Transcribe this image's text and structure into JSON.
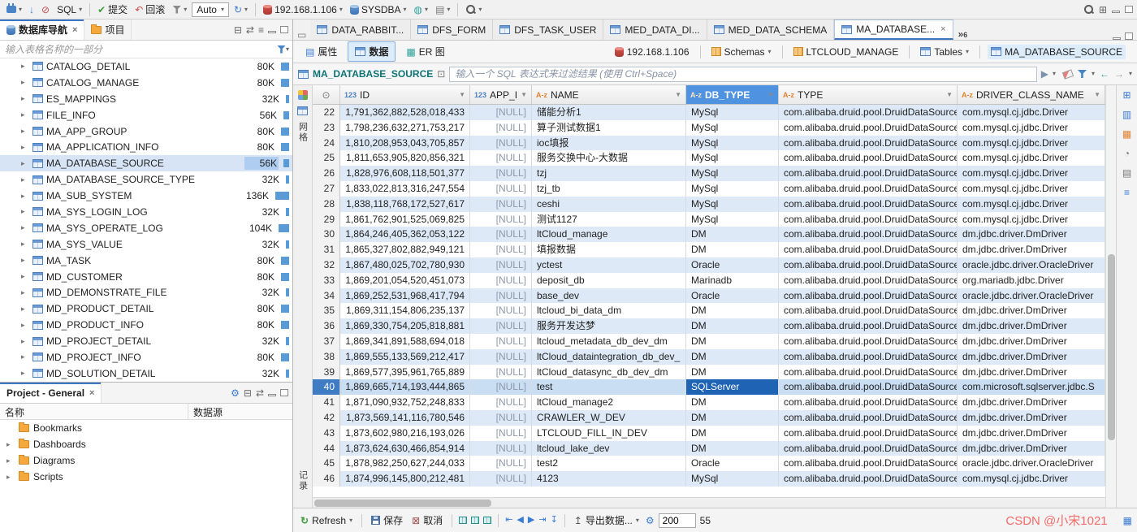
{
  "topbar": {
    "sql_label": "SQL",
    "commit_label": "提交",
    "rollback_label": "回滚",
    "auto_value": "Auto",
    "host": "192.168.1.106",
    "user": "SYSDBA"
  },
  "navigator": {
    "tabs": [
      "数据库导航",
      "项目"
    ],
    "filter_placeholder": "输入表格名称的一部分",
    "tree": [
      {
        "name": "CATALOG_DETAIL",
        "size": "80K"
      },
      {
        "name": "CATALOG_MANAGE",
        "size": "80K"
      },
      {
        "name": "ES_MAPPINGS",
        "size": "32K"
      },
      {
        "name": "FILE_INFO",
        "size": "56K"
      },
      {
        "name": "MA_APP_GROUP",
        "size": "80K"
      },
      {
        "name": "MA_APPLICATION_INFO",
        "size": "80K"
      },
      {
        "name": "MA_DATABASE_SOURCE",
        "size": "56K",
        "selected": true
      },
      {
        "name": "MA_DATABASE_SOURCE_TYPE",
        "size": "32K"
      },
      {
        "name": "MA_SUB_SYSTEM",
        "size": "136K"
      },
      {
        "name": "MA_SYS_LOGIN_LOG",
        "size": "32K"
      },
      {
        "name": "MA_SYS_OPERATE_LOG",
        "size": "104K"
      },
      {
        "name": "MA_SYS_VALUE",
        "size": "32K"
      },
      {
        "name": "MA_TASK",
        "size": "80K"
      },
      {
        "name": "MD_CUSTOMER",
        "size": "80K"
      },
      {
        "name": "MD_DEMONSTRATE_FILE",
        "size": "32K"
      },
      {
        "name": "MD_PRODUCT_DETAIL",
        "size": "80K"
      },
      {
        "name": "MD_PRODUCT_INFO",
        "size": "80K"
      },
      {
        "name": "MD_PROJECT_DETAIL",
        "size": "32K"
      },
      {
        "name": "MD_PROJECT_INFO",
        "size": "80K"
      },
      {
        "name": "MD_SOLUTION_DETAIL",
        "size": "32K"
      }
    ]
  },
  "project": {
    "tab_label": "Project - General",
    "columns": [
      "名称",
      "数据源"
    ],
    "items": [
      {
        "label": "Bookmarks",
        "expandable": false
      },
      {
        "label": "Dashboards",
        "expandable": true
      },
      {
        "label": "Diagrams",
        "expandable": true
      },
      {
        "label": "Scripts",
        "expandable": true
      }
    ]
  },
  "editor": {
    "tabs": [
      {
        "label": "DATA_RABBIT..."
      },
      {
        "label": "DFS_FORM"
      },
      {
        "label": "DFS_TASK_USER"
      },
      {
        "label": "MED_DATA_DI..."
      },
      {
        "label": "MED_DATA_SCHEMA"
      },
      {
        "label": "MA_DATABASE...",
        "active": true
      }
    ],
    "overflow_chevron": "»",
    "overflow_count": "6"
  },
  "subtabs": [
    {
      "label": "属性"
    },
    {
      "label": "数据",
      "active": true
    },
    {
      "label": "ER 图"
    }
  ],
  "breadcrumbs": [
    {
      "icon": "db-red",
      "label": "192.168.1.106",
      "caret": false
    },
    {
      "icon": "schemas",
      "label": "Schemas",
      "caret": true
    },
    {
      "icon": "schema",
      "label": "LTCLOUD_MANAGE",
      "caret": false
    },
    {
      "icon": "tables",
      "label": "Tables",
      "caret": true
    },
    {
      "icon": "table",
      "label": "MA_DATABASE_SOURCE",
      "caret": false,
      "current": true
    }
  ],
  "grid_toolbar": {
    "table_name": "MA_DATABASE_SOURCE",
    "filter_placeholder": "输入一个 SQL 表达式来过滤结果 (使用 Ctrl+Space)"
  },
  "grid": {
    "columns": [
      {
        "key": "rownum",
        "label": "",
        "badge": ""
      },
      {
        "key": "id",
        "label": "ID",
        "badge": "123"
      },
      {
        "key": "app_id",
        "label": "APP_ID",
        "badge": "123"
      },
      {
        "key": "name",
        "label": "NAME",
        "badge": "A-z"
      },
      {
        "key": "db_type",
        "label": "DB_TYPE",
        "badge": "A-z",
        "selected": true
      },
      {
        "key": "type",
        "label": "TYPE",
        "badge": "A-z"
      },
      {
        "key": "driver",
        "label": "DRIVER_CLASS_NAME",
        "badge": "A-z"
      }
    ],
    "selected_row": 40,
    "selected_column": "db_type",
    "rows": [
      {
        "num": 22,
        "id": "1,791,362,882,528,018,433",
        "app_id": "[NULL]",
        "name": "储能分析1",
        "db_type": "MySql",
        "type": "com.alibaba.druid.pool.DruidDataSource",
        "driver": "com.mysql.cj.jdbc.Driver"
      },
      {
        "num": 23,
        "id": "1,798,236,632,271,753,217",
        "app_id": "[NULL]",
        "name": "算子测试数据1",
        "db_type": "MySql",
        "type": "com.alibaba.druid.pool.DruidDataSource",
        "driver": "com.mysql.cj.jdbc.Driver"
      },
      {
        "num": 24,
        "id": "1,810,208,953,043,705,857",
        "app_id": "[NULL]",
        "name": "ioc填报",
        "db_type": "MySql",
        "type": "com.alibaba.druid.pool.DruidDataSource",
        "driver": "com.mysql.cj.jdbc.Driver"
      },
      {
        "num": 25,
        "id": "1,811,653,905,820,856,321",
        "app_id": "[NULL]",
        "name": "服务交换中心-大数据",
        "db_type": "MySql",
        "type": "com.alibaba.druid.pool.DruidDataSource",
        "driver": "com.mysql.cj.jdbc.Driver"
      },
      {
        "num": 26,
        "id": "1,828,976,608,118,501,377",
        "app_id": "[NULL]",
        "name": "tzj",
        "db_type": "MySql",
        "type": "com.alibaba.druid.pool.DruidDataSource",
        "driver": "com.mysql.cj.jdbc.Driver"
      },
      {
        "num": 27,
        "id": "1,833,022,813,316,247,554",
        "app_id": "[NULL]",
        "name": "tzj_tb",
        "db_type": "MySql",
        "type": "com.alibaba.druid.pool.DruidDataSource",
        "driver": "com.mysql.cj.jdbc.Driver"
      },
      {
        "num": 28,
        "id": "1,838,118,768,172,527,617",
        "app_id": "[NULL]",
        "name": "ceshi",
        "db_type": "MySql",
        "type": "com.alibaba.druid.pool.DruidDataSource",
        "driver": "com.mysql.cj.jdbc.Driver"
      },
      {
        "num": 29,
        "id": "1,861,762,901,525,069,825",
        "app_id": "[NULL]",
        "name": "测试1127",
        "db_type": "MySql",
        "type": "com.alibaba.druid.pool.DruidDataSource",
        "driver": "com.mysql.cj.jdbc.Driver"
      },
      {
        "num": 30,
        "id": "1,864,246,405,362,053,122",
        "app_id": "[NULL]",
        "name": "ltCloud_manage",
        "db_type": "DM",
        "type": "com.alibaba.druid.pool.DruidDataSource",
        "driver": "dm.jdbc.driver.DmDriver"
      },
      {
        "num": 31,
        "id": "1,865,327,802,882,949,121",
        "app_id": "[NULL]",
        "name": "填报数据",
        "db_type": "DM",
        "type": "com.alibaba.druid.pool.DruidDataSource",
        "driver": "dm.jdbc.driver.DmDriver"
      },
      {
        "num": 32,
        "id": "1,867,480,025,702,780,930",
        "app_id": "[NULL]",
        "name": "yctest",
        "db_type": "Oracle",
        "type": "com.alibaba.druid.pool.DruidDataSource",
        "driver": "oracle.jdbc.driver.OracleDriver"
      },
      {
        "num": 33,
        "id": "1,869,201,054,520,451,073",
        "app_id": "[NULL]",
        "name": "deposit_db",
        "db_type": "Marinadb",
        "type": "com.alibaba.druid.pool.DruidDataSource",
        "driver": "org.mariadb.jdbc.Driver"
      },
      {
        "num": 34,
        "id": "1,869,252,531,968,417,794",
        "app_id": "[NULL]",
        "name": "base_dev",
        "db_type": "Oracle",
        "type": "com.alibaba.druid.pool.DruidDataSource",
        "driver": "oracle.jdbc.driver.OracleDriver"
      },
      {
        "num": 35,
        "id": "1,869,311,154,806,235,137",
        "app_id": "[NULL]",
        "name": "ltcloud_bi_data_dm",
        "db_type": "DM",
        "type": "com.alibaba.druid.pool.DruidDataSource",
        "driver": "dm.jdbc.driver.DmDriver"
      },
      {
        "num": 36,
        "id": "1,869,330,754,205,818,881",
        "app_id": "[NULL]",
        "name": "服务开发达梦",
        "db_type": "DM",
        "type": "com.alibaba.druid.pool.DruidDataSource",
        "driver": "dm.jdbc.driver.DmDriver"
      },
      {
        "num": 37,
        "id": "1,869,341,891,588,694,018",
        "app_id": "[NULL]",
        "name": "ltcloud_metadata_db_dev_dm",
        "db_type": "DM",
        "type": "com.alibaba.druid.pool.DruidDataSource",
        "driver": "dm.jdbc.driver.DmDriver"
      },
      {
        "num": 38,
        "id": "1,869,555,133,569,212,417",
        "app_id": "[NULL]",
        "name": "ltCloud_dataintegration_db_dev_",
        "db_type": "DM",
        "type": "com.alibaba.druid.pool.DruidDataSource",
        "driver": "dm.jdbc.driver.DmDriver"
      },
      {
        "num": 39,
        "id": "1,869,577,395,961,765,889",
        "app_id": "[NULL]",
        "name": "ltCloud_datasync_db_dev_dm",
        "db_type": "DM",
        "type": "com.alibaba.druid.pool.DruidDataSource",
        "driver": "dm.jdbc.driver.DmDriver"
      },
      {
        "num": 40,
        "id": "1,869,665,714,193,444,865",
        "app_id": "[NULL]",
        "name": "test",
        "db_type": "SQLServer",
        "type": "com.alibaba.druid.pool.DruidDataSource",
        "driver": "com.microsoft.sqlserver.jdbc.S"
      },
      {
        "num": 41,
        "id": "1,871,090,932,752,248,833",
        "app_id": "[NULL]",
        "name": "ltCloud_manage2",
        "db_type": "DM",
        "type": "com.alibaba.druid.pool.DruidDataSource",
        "driver": "dm.jdbc.driver.DmDriver"
      },
      {
        "num": 42,
        "id": "1,873,569,141,116,780,546",
        "app_id": "[NULL]",
        "name": "CRAWLER_W_DEV",
        "db_type": "DM",
        "type": "com.alibaba.druid.pool.DruidDataSource",
        "driver": "dm.jdbc.driver.DmDriver"
      },
      {
        "num": 43,
        "id": "1,873,602,980,216,193,026",
        "app_id": "[NULL]",
        "name": "LTCLOUD_FILL_IN_DEV",
        "db_type": "DM",
        "type": "com.alibaba.druid.pool.DruidDataSource",
        "driver": "dm.jdbc.driver.DmDriver"
      },
      {
        "num": 44,
        "id": "1,873,624,630,466,854,914",
        "app_id": "[NULL]",
        "name": "ltcloud_lake_dev",
        "db_type": "DM",
        "type": "com.alibaba.druid.pool.DruidDataSource",
        "driver": "dm.jdbc.driver.DmDriver"
      },
      {
        "num": 45,
        "id": "1,878,982,250,627,244,033",
        "app_id": "[NULL]",
        "name": "test2",
        "db_type": "Oracle",
        "type": "com.alibaba.druid.pool.DruidDataSource",
        "driver": "oracle.jdbc.driver.OracleDriver"
      },
      {
        "num": 46,
        "id": "1,874,996,145,800,212,481",
        "app_id": "[NULL]",
        "name": "4123",
        "db_type": "MySql",
        "type": "com.alibaba.druid.pool.DruidDataSource",
        "driver": "com.mysql.cj.jdbc.Driver"
      }
    ]
  },
  "left_strip": {
    "top_label": "网格",
    "bottom_label": "记录"
  },
  "statusbar": {
    "refresh": "Refresh",
    "save": "保存",
    "cancel": "取消",
    "export": "导出数据...",
    "fetch_size": "200",
    "row_count": "55"
  },
  "watermark": "CSDN @小宋1021",
  "colors": {
    "accent": "#3a76c4",
    "selection": "#1f63b5",
    "alt_row": "#dde9f7",
    "header_selected": "#4f93e0"
  }
}
